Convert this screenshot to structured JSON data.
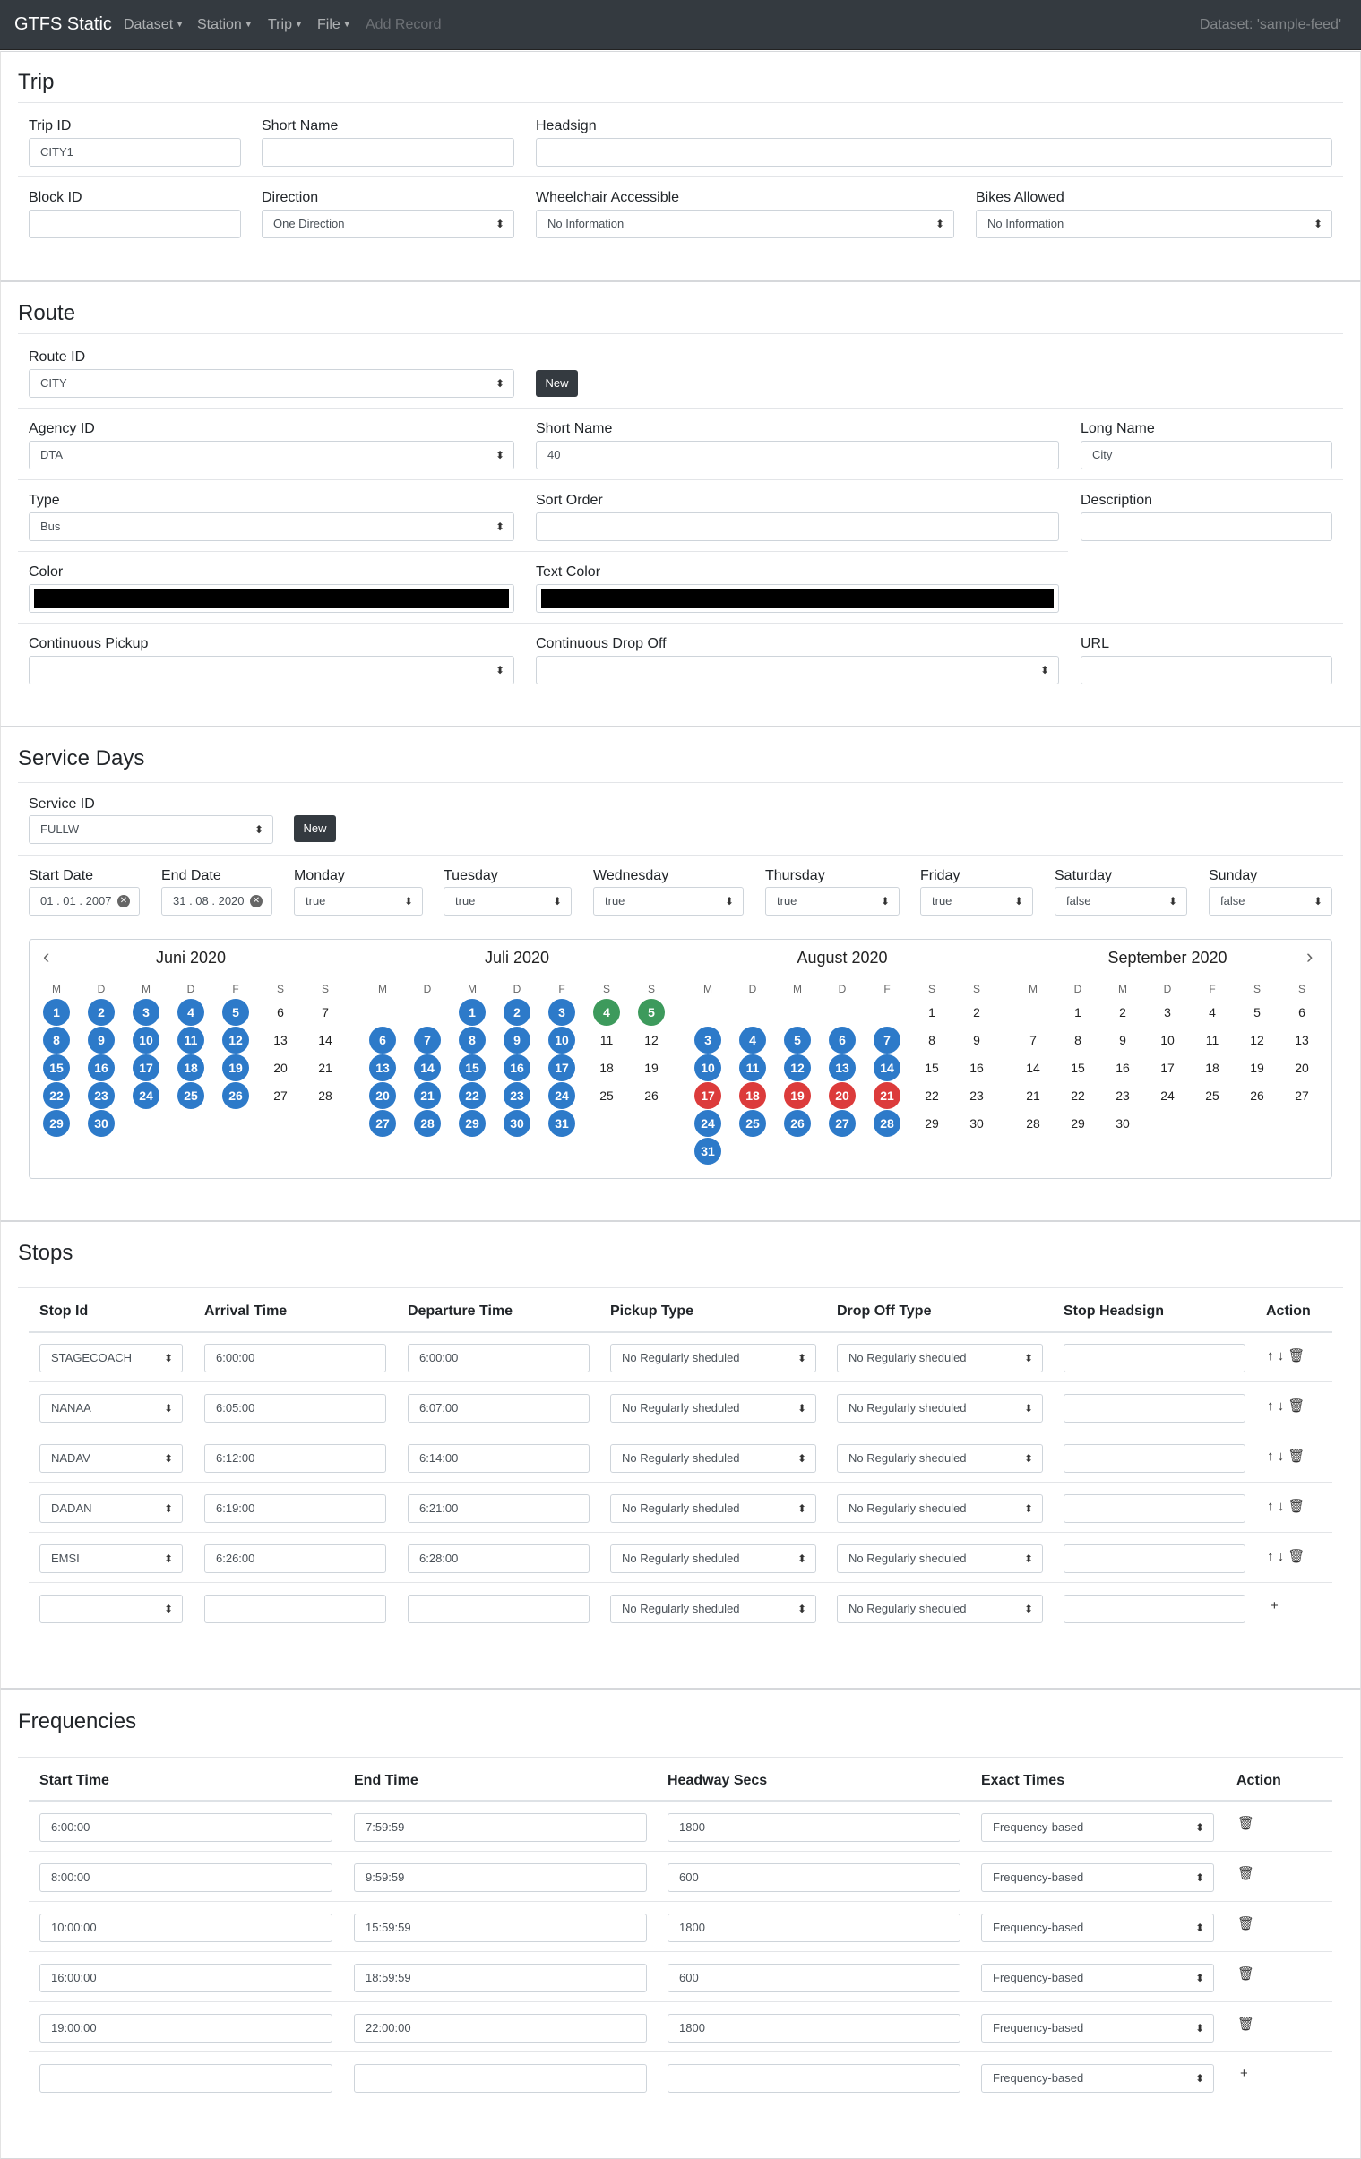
{
  "nav": {
    "brand": "GTFS Static",
    "menus": [
      "Dataset",
      "Station",
      "Trip",
      "File"
    ],
    "add_record": "Add Record",
    "dataset": "Dataset: 'sample-feed'"
  },
  "trip": {
    "title": "Trip",
    "trip_id_label": "Trip ID",
    "trip_id": "CITY1",
    "short_name_label": "Short Name",
    "short_name": "",
    "headsign_label": "Headsign",
    "headsign": "",
    "block_id_label": "Block ID",
    "block_id": "",
    "direction_label": "Direction",
    "direction": "One Direction",
    "wheelchair_label": "Wheelchair Accessible",
    "wheelchair": "No Information",
    "bikes_label": "Bikes Allowed",
    "bikes": "No Information"
  },
  "route": {
    "title": "Route",
    "route_id_label": "Route ID",
    "route_id": "CITY",
    "new_label": "New",
    "agency_label": "Agency ID",
    "agency": "DTA",
    "short_name_label": "Short Name",
    "short_name": "40",
    "long_name_label": "Long Name",
    "long_name": "City",
    "type_label": "Type",
    "type": "Bus",
    "sort_label": "Sort Order",
    "description_label": "Description",
    "color_label": "Color",
    "text_color_label": "Text Color",
    "color": "#000000",
    "text_color": "#000000",
    "pickup_label": "Continuous Pickup",
    "dropoff_label": "Continuous Drop Off",
    "url_label": "URL"
  },
  "service": {
    "title": "Service Days",
    "service_id_label": "Service ID",
    "service_id": "FULLW",
    "new_label": "New",
    "start_label": "Start Date",
    "start": "01 . 01 . 2007",
    "end_label": "End Date",
    "end": "31 . 08 . 2020",
    "days": [
      {
        "label": "Monday",
        "value": "true"
      },
      {
        "label": "Tuesday",
        "value": "true"
      },
      {
        "label": "Wednesday",
        "value": "true"
      },
      {
        "label": "Thursday",
        "value": "true"
      },
      {
        "label": "Friday",
        "value": "true"
      },
      {
        "label": "Saturday",
        "value": "false"
      },
      {
        "label": "Sunday",
        "value": "false"
      }
    ],
    "weekday_initials": [
      "M",
      "D",
      "M",
      "D",
      "F",
      "S",
      "S"
    ],
    "colors": {
      "active": "#2d7ac9",
      "added": "#3d9a5c",
      "removed": "#dc3b3b"
    },
    "months": [
      {
        "name": "Juni 2020",
        "first_col": 0,
        "days": 30,
        "active": [
          1,
          2,
          3,
          4,
          5,
          8,
          9,
          10,
          11,
          12,
          15,
          16,
          17,
          18,
          19,
          22,
          23,
          24,
          25,
          26,
          29,
          30
        ],
        "added": [],
        "removed": []
      },
      {
        "name": "Juli 2020",
        "first_col": 2,
        "days": 31,
        "active": [
          1,
          2,
          3,
          6,
          7,
          8,
          9,
          10,
          13,
          14,
          15,
          16,
          17,
          20,
          21,
          22,
          23,
          24,
          27,
          28,
          29,
          30,
          31
        ],
        "added": [
          4,
          5
        ],
        "removed": []
      },
      {
        "name": "August 2020",
        "first_col": 5,
        "days": 31,
        "active": [
          3,
          4,
          5,
          6,
          7,
          10,
          11,
          12,
          13,
          14,
          24,
          25,
          26,
          27,
          28,
          31
        ],
        "added": [],
        "removed": [
          17,
          18,
          19,
          20,
          21
        ]
      },
      {
        "name": "September 2020",
        "first_col": 1,
        "days": 30,
        "active": [],
        "added": [],
        "removed": []
      }
    ]
  },
  "stops": {
    "title": "Stops",
    "headers": [
      "Stop Id",
      "Arrival Time",
      "Departure Time",
      "Pickup Type",
      "Drop Off Type",
      "Stop Headsign",
      "Action"
    ],
    "rows": [
      {
        "stop": "STAGECOACH",
        "arrival": "6:00:00",
        "departure": "6:00:00",
        "pickup": "No Regularly sheduled",
        "dropoff": "No Regularly sheduled",
        "headsign": ""
      },
      {
        "stop": "NANAA",
        "arrival": "6:05:00",
        "departure": "6:07:00",
        "pickup": "No Regularly sheduled",
        "dropoff": "No Regularly sheduled",
        "headsign": ""
      },
      {
        "stop": "NADAV",
        "arrival": "6:12:00",
        "departure": "6:14:00",
        "pickup": "No Regularly sheduled",
        "dropoff": "No Regularly sheduled",
        "headsign": ""
      },
      {
        "stop": "DADAN",
        "arrival": "6:19:00",
        "departure": "6:21:00",
        "pickup": "No Regularly sheduled",
        "dropoff": "No Regularly sheduled",
        "headsign": ""
      },
      {
        "stop": "EMSI",
        "arrival": "6:26:00",
        "departure": "6:28:00",
        "pickup": "No Regularly sheduled",
        "dropoff": "No Regularly sheduled",
        "headsign": ""
      },
      {
        "stop": "",
        "arrival": "",
        "departure": "",
        "pickup": "No Regularly sheduled",
        "dropoff": "No Regularly sheduled",
        "headsign": ""
      }
    ]
  },
  "frequencies": {
    "title": "Frequencies",
    "headers": [
      "Start Time",
      "End Time",
      "Headway Secs",
      "Exact Times",
      "Action"
    ],
    "rows": [
      {
        "start": "6:00:00",
        "end": "7:59:59",
        "headway": "1800",
        "exact": "Frequency-based"
      },
      {
        "start": "8:00:00",
        "end": "9:59:59",
        "headway": "600",
        "exact": "Frequency-based"
      },
      {
        "start": "10:00:00",
        "end": "15:59:59",
        "headway": "1800",
        "exact": "Frequency-based"
      },
      {
        "start": "16:00:00",
        "end": "18:59:59",
        "headway": "600",
        "exact": "Frequency-based"
      },
      {
        "start": "19:00:00",
        "end": "22:00:00",
        "headway": "1800",
        "exact": "Frequency-based"
      },
      {
        "start": "",
        "end": "",
        "headway": "",
        "exact": "Frequency-based"
      }
    ]
  }
}
